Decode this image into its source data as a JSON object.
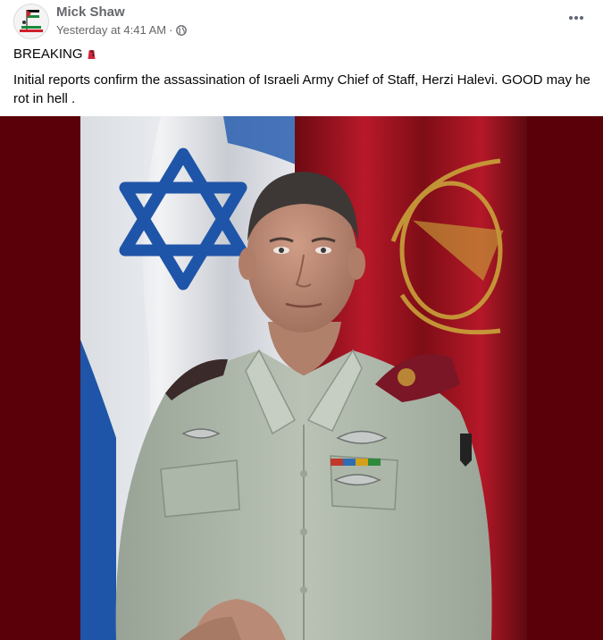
{
  "author": {
    "name": "Mick Shaw",
    "avatar_icon": "palestine-flag-avatar-icon"
  },
  "meta": {
    "time": "Yesterday at 4:41 AM",
    "separator": "·",
    "audience_icon": "globe-icon"
  },
  "menu": {
    "icon": "more-options-icon"
  },
  "post": {
    "headline": "BREAKING",
    "headline_emoji": "red-fez-emoji-icon",
    "body": "Initial reports confirm the assassination of Israeli Army Chief of Staff, Herzi Halevi. GOOD may he rot in hell ."
  },
  "photo": {
    "subject": "portrait-photo",
    "colors": {
      "background": "#5a0008",
      "flag_blue": "#1f55a8",
      "flag_white": "#e6e8ec",
      "uniform": "#aeb8ab",
      "beret": "#7a1626",
      "insignia_gold": "#c9a23a"
    }
  }
}
